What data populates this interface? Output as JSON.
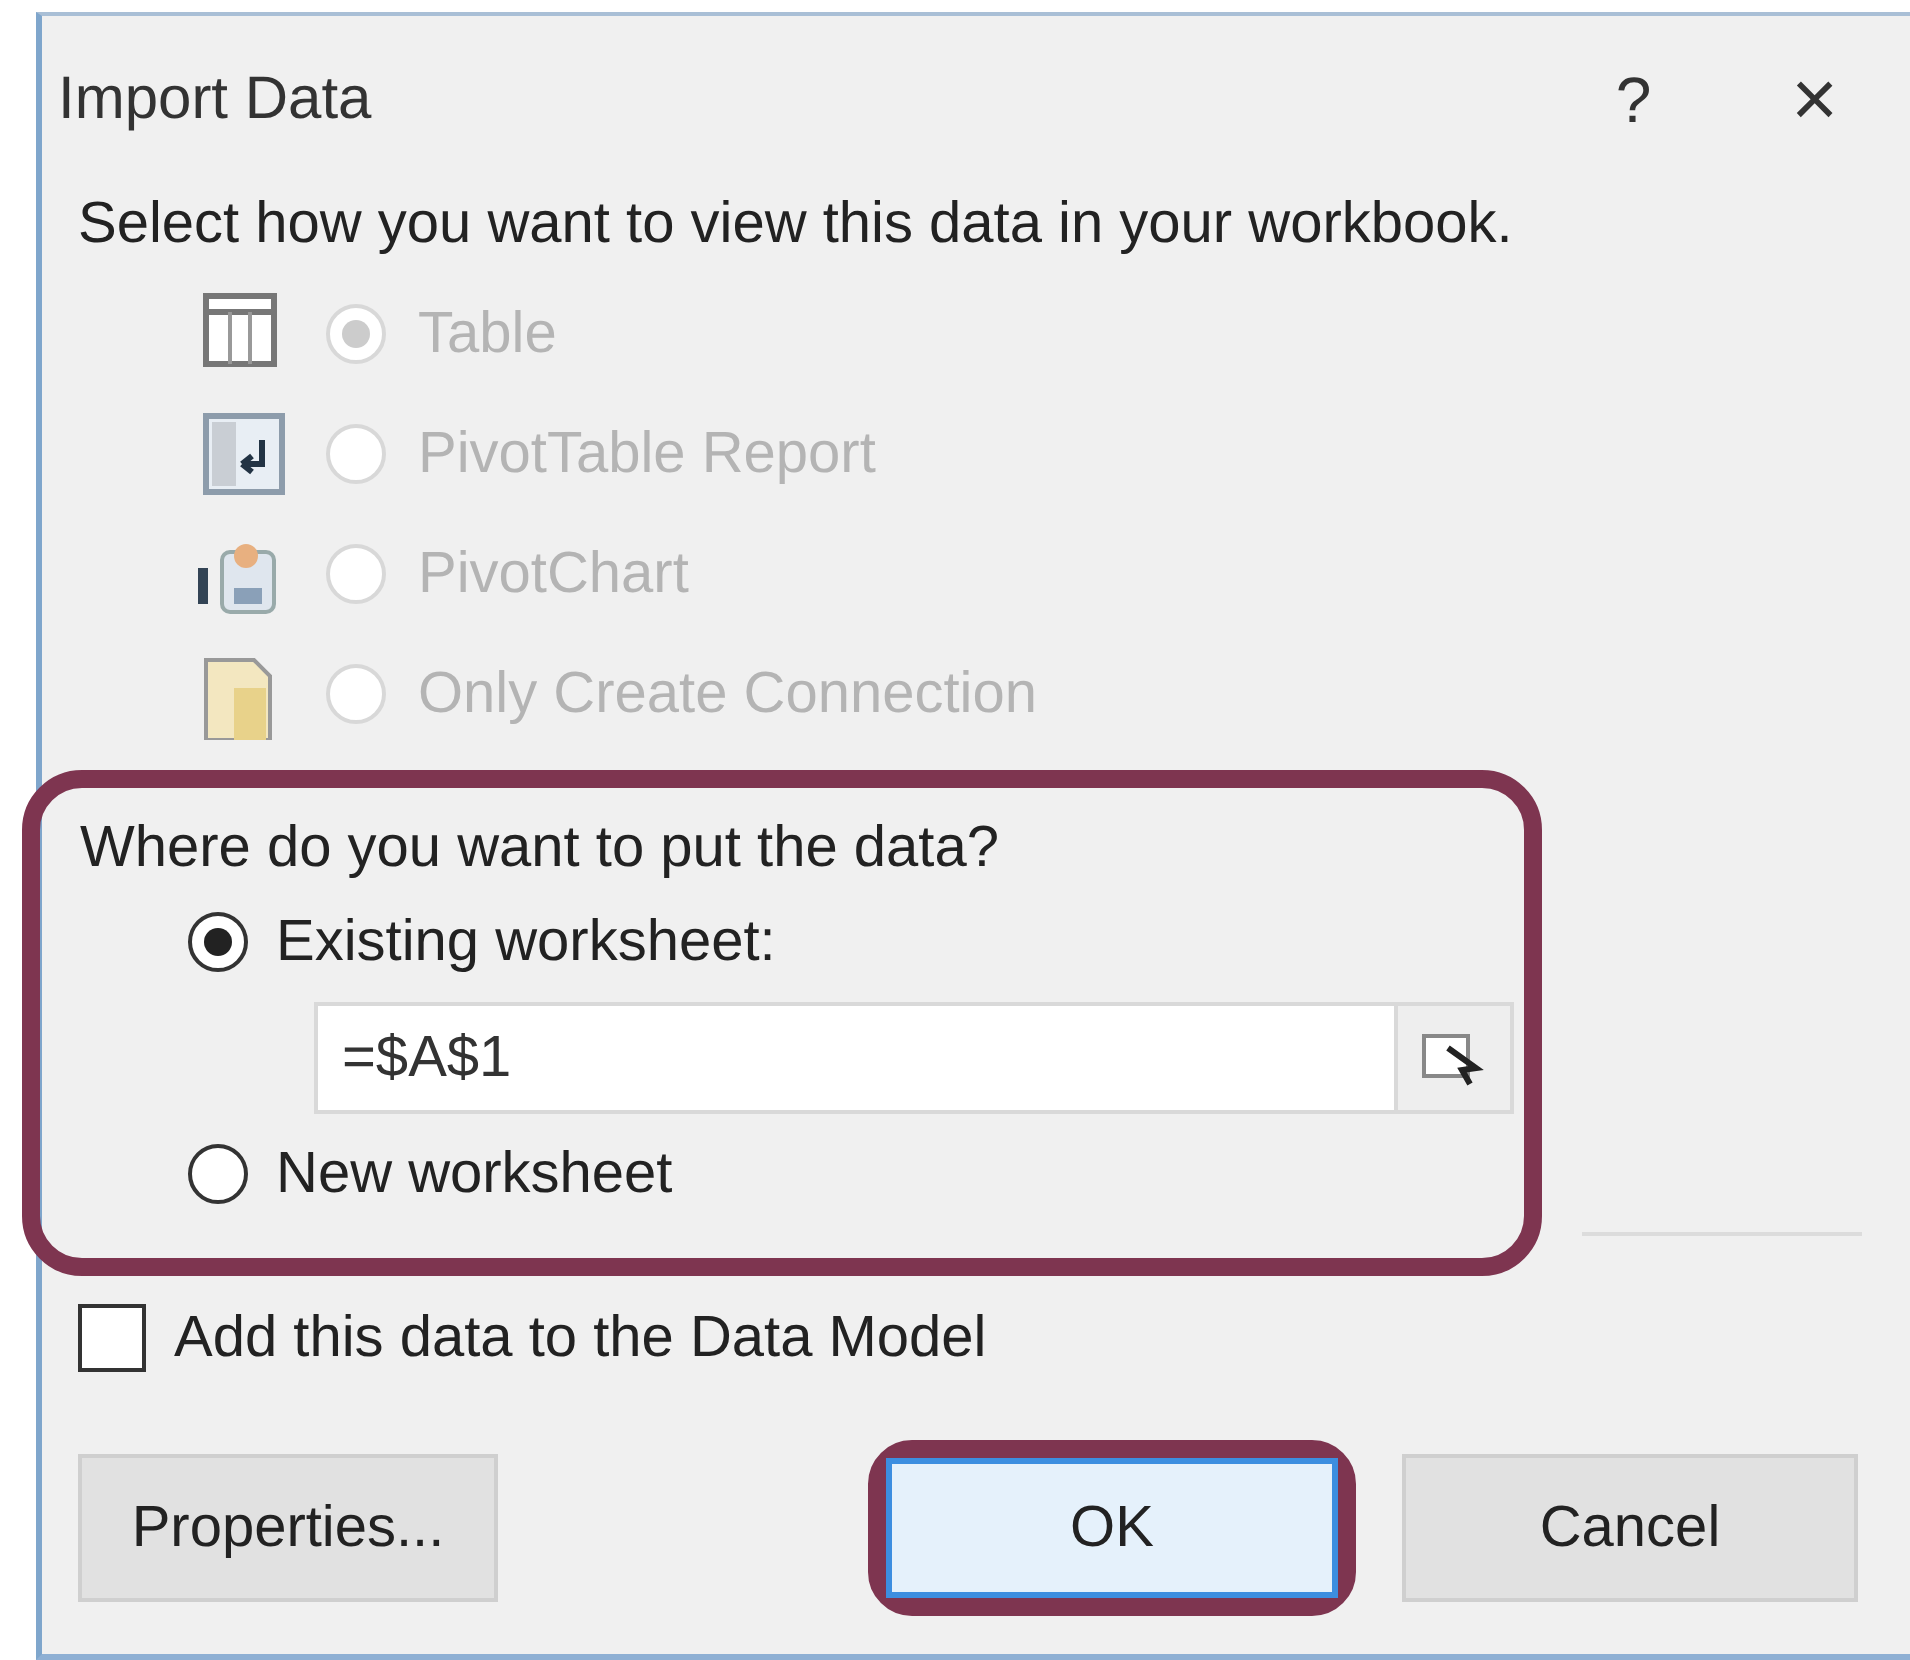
{
  "window": {
    "title": "Import Data",
    "help": "?",
    "close": "×"
  },
  "view_prompt": "Select how you want to view this data in your workbook.",
  "view_options": [
    {
      "kind": "table",
      "label": "Table",
      "selected": true,
      "disabled": true
    },
    {
      "kind": "pivottable",
      "label": "PivotTable Report",
      "selected": false,
      "disabled": true
    },
    {
      "kind": "pivotchart",
      "label": "PivotChart",
      "selected": false,
      "disabled": true
    },
    {
      "kind": "connection",
      "label": "Only Create Connection",
      "selected": false,
      "disabled": true
    }
  ],
  "location": {
    "highlighted": true,
    "prompt": "Where do you want to put the data?",
    "options": [
      {
        "label": "Existing worksheet:",
        "selected": true
      },
      {
        "label": "New worksheet",
        "selected": false
      }
    ],
    "cell_reference": "=$A$1"
  },
  "data_model": {
    "label": "Add this data to the Data Model",
    "checked": false
  },
  "buttons": [
    {
      "label": "Properties...",
      "default": false,
      "highlighted": false
    },
    {
      "label": "OK",
      "default": true,
      "highlighted": true
    },
    {
      "label": "Cancel",
      "default": false,
      "highlighted": false
    }
  ]
}
